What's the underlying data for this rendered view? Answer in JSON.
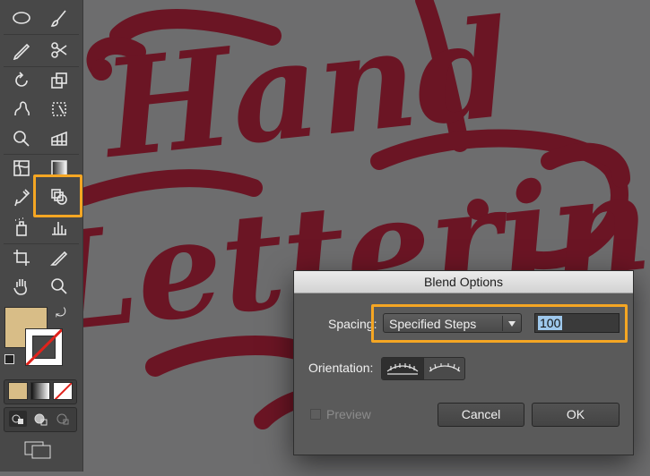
{
  "canvas": {
    "lettering_line1": "Hand",
    "lettering_line2": "Lettering",
    "lettering_color": "#6b1524",
    "background_color": "#6d6d6e"
  },
  "toolbar": {
    "tools": [
      {
        "id": "ellipse",
        "icon": "ellipse-icon"
      },
      {
        "id": "paintbrush",
        "icon": "paintbrush-icon"
      },
      {
        "id": "pencil",
        "icon": "pencil-icon"
      },
      {
        "id": "scissors",
        "icon": "scissors-icon"
      },
      {
        "id": "rotate",
        "icon": "rotate-icon"
      },
      {
        "id": "scale",
        "icon": "scale-icon"
      },
      {
        "id": "warp",
        "icon": "warp-icon"
      },
      {
        "id": "free-transform",
        "icon": "free-transform-icon"
      },
      {
        "id": "shape-builder",
        "icon": "shape-builder-icon"
      },
      {
        "id": "perspective",
        "icon": "perspective-grid-icon"
      },
      {
        "id": "mesh",
        "icon": "mesh-icon"
      },
      {
        "id": "gradient",
        "icon": "gradient-icon"
      },
      {
        "id": "eyedropper",
        "icon": "eyedropper-icon"
      },
      {
        "id": "blend",
        "icon": "blend-icon",
        "highlighted": true
      },
      {
        "id": "symbol-sprayer",
        "icon": "symbol-sprayer-icon"
      },
      {
        "id": "column-graph",
        "icon": "column-graph-icon"
      },
      {
        "id": "artboard",
        "icon": "artboard-icon"
      },
      {
        "id": "slice",
        "icon": "slice-icon"
      },
      {
        "id": "hand",
        "icon": "hand-icon"
      },
      {
        "id": "zoom",
        "icon": "zoom-icon"
      }
    ],
    "fill_color": "#d8bd87",
    "stroke_color": "none",
    "accent_highlight": "#f5a623"
  },
  "dialog": {
    "title": "Blend Options",
    "spacing_label": "Spacing:",
    "spacing_value": "Specified Steps",
    "spacing_options_visible": [
      "Specified Steps"
    ],
    "steps_value": "100",
    "orientation_label": "Orientation:",
    "orientation_selected": "align-to-page",
    "preview_label": "Preview",
    "preview_checked": false,
    "cancel_label": "Cancel",
    "ok_label": "OK"
  }
}
